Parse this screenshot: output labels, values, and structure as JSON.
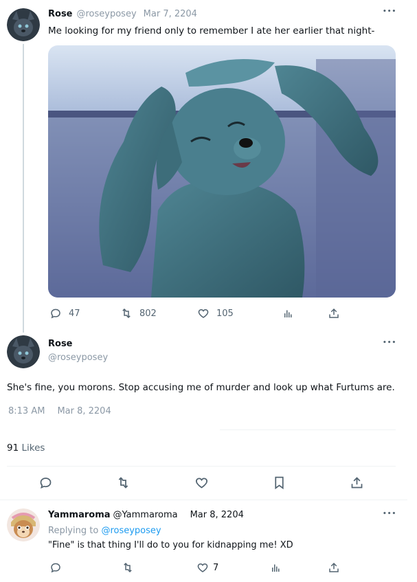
{
  "tweet1": {
    "name": "Rose",
    "handle": "@roseyposey",
    "date": "Mar 7, 2204",
    "text": "Me looking for my friend only to remember I ate her earlier that night-",
    "replies": "47",
    "retweets": "802",
    "likes": "105",
    "more": "•••"
  },
  "tweet2": {
    "name": "Rose",
    "handle": "@roseyposey",
    "text": "She's fine, you morons. Stop accusing me of murder and look up what Furtums are.",
    "time": "8:13 AM",
    "date": "Mar 8, 2204",
    "likes_count": "91",
    "likes_label": "Likes",
    "more": "•••"
  },
  "reply": {
    "name": "Yammaroma",
    "handle": "@Yammaroma",
    "date": "Mar 8, 2204",
    "replying_prefix": "Replying to",
    "replying_to": "@roseyposey",
    "text": "\"Fine\" is that thing I'll do to you for kidnapping me! XD",
    "likes": "7",
    "more": "•••"
  },
  "colors": {
    "text": "#0f1419",
    "muted": "#8b98a5",
    "link": "#1d9bf0",
    "image_bg": "#5a6a9a",
    "character": "#3f6f7c"
  }
}
